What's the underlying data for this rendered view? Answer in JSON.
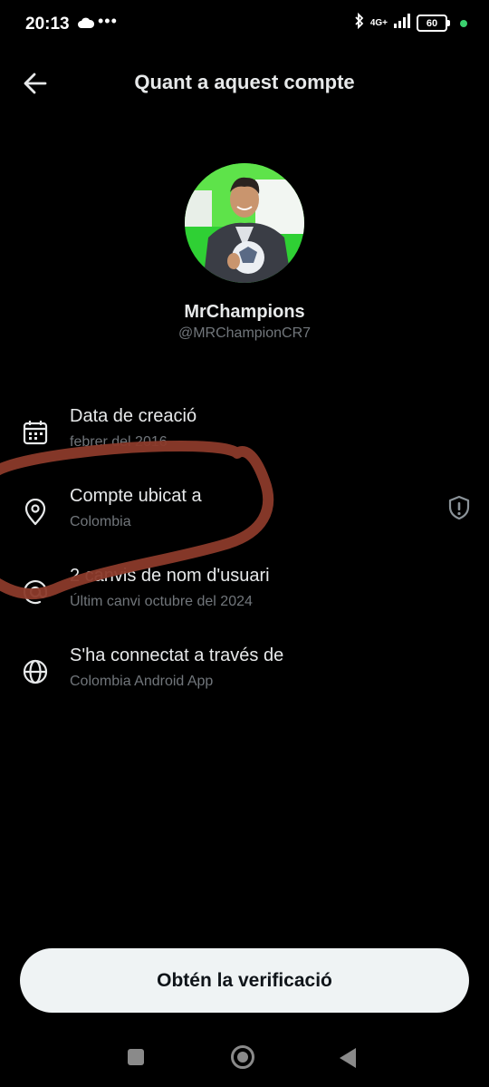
{
  "status_bar": {
    "time": "20:13",
    "icons": [
      "cloud-icon",
      "more-dots-icon",
      "bluetooth-icon",
      "signal-icon",
      "battery-icon"
    ],
    "dots": "•••",
    "network": "4G+",
    "battery": "60"
  },
  "header": {
    "title": "Quant a aquest compte"
  },
  "profile": {
    "name": "MrChampions",
    "handle": "@MRChampionCR7"
  },
  "details": [
    {
      "icon": "calendar-icon",
      "label": "Data de creació",
      "value": "febrer del 2016"
    },
    {
      "icon": "location-pin-icon",
      "label": "Compte ubicat a",
      "value": "Colombia"
    },
    {
      "icon": "at-sign-icon",
      "label": "2 canvis de nom d'usuari",
      "value": "Últim canvi octubre del 2024"
    },
    {
      "icon": "globe-icon",
      "label": "S'ha connectat a través de",
      "value": "Colombia Android App"
    }
  ],
  "verify_button": {
    "label": "Obtén la verificació"
  },
  "colors": {
    "background": "#000000",
    "primary_text": "#e7e9ea",
    "secondary_text": "#71767b",
    "button_bg": "#eff3f4",
    "annotation": "#8b3a2a",
    "status_dot": "#3bd16f"
  },
  "nav_bar": {
    "icons": [
      "recents-square-icon",
      "home-circle-icon",
      "back-triangle-icon"
    ]
  }
}
